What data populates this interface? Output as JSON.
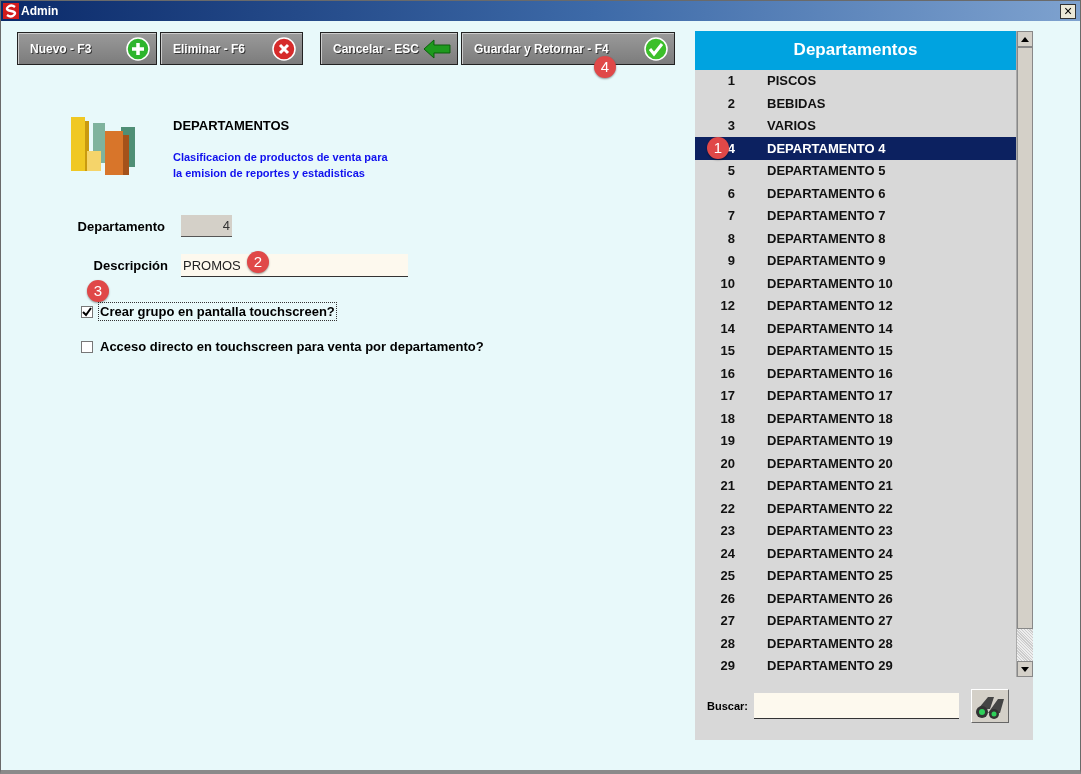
{
  "window": {
    "title": "Admin",
    "close": "×"
  },
  "toolbar": [
    {
      "label": "Nuevo - F3",
      "kind": "add"
    },
    {
      "label": "Eliminar - F6",
      "kind": "delete"
    },
    {
      "label": "Cancelar - ESC",
      "kind": "back"
    },
    {
      "label": "Guardar y Retornar - F4",
      "kind": "ok",
      "badge": "4"
    }
  ],
  "header": {
    "title": "DEPARTAMENTOS",
    "description": "Clasificacion de productos de venta para la emision de reportes y estadisticas"
  },
  "form": {
    "department": {
      "label": "Departamento",
      "value": "4"
    },
    "description": {
      "label": "Descripción",
      "value": "PROMOS",
      "badge": "2"
    },
    "checkboxes": [
      {
        "label": "Crear grupo en pantalla touchscreen?",
        "checked": true,
        "badge": "3"
      },
      {
        "label": "Acceso directo en touchscreen para venta por departamento?",
        "checked": false
      }
    ]
  },
  "list": {
    "title": "Departamentos",
    "items": [
      {
        "number": "1",
        "name": "PISCOS",
        "selected": false
      },
      {
        "number": "2",
        "name": "BEBIDAS",
        "selected": false
      },
      {
        "number": "3",
        "name": "VARIOS",
        "selected": false
      },
      {
        "number": "4",
        "name": "DEPARTAMENTO 4",
        "selected": true,
        "badge": "1"
      },
      {
        "number": "5",
        "name": "DEPARTAMENTO 5",
        "selected": false
      },
      {
        "number": "6",
        "name": "DEPARTAMENTO 6",
        "selected": false
      },
      {
        "number": "7",
        "name": "DEPARTAMENTO 7",
        "selected": false
      },
      {
        "number": "8",
        "name": "DEPARTAMENTO 8",
        "selected": false
      },
      {
        "number": "9",
        "name": "DEPARTAMENTO 9",
        "selected": false
      },
      {
        "number": "10",
        "name": "DEPARTAMENTO 10",
        "selected": false
      },
      {
        "number": "12",
        "name": "DEPARTAMENTO 12",
        "selected": false
      },
      {
        "number": "14",
        "name": "DEPARTAMENTO 14",
        "selected": false
      },
      {
        "number": "15",
        "name": "DEPARTAMENTO 15",
        "selected": false
      },
      {
        "number": "16",
        "name": "DEPARTAMENTO 16",
        "selected": false
      },
      {
        "number": "17",
        "name": "DEPARTAMENTO 17",
        "selected": false
      },
      {
        "number": "18",
        "name": "DEPARTAMENTO 18",
        "selected": false
      },
      {
        "number": "19",
        "name": "DEPARTAMENTO 19",
        "selected": false
      },
      {
        "number": "20",
        "name": "DEPARTAMENTO 20",
        "selected": false
      },
      {
        "number": "21",
        "name": "DEPARTAMENTO 21",
        "selected": false
      },
      {
        "number": "22",
        "name": "DEPARTAMENTO 22",
        "selected": false
      },
      {
        "number": "23",
        "name": "DEPARTAMENTO 23",
        "selected": false
      },
      {
        "number": "24",
        "name": "DEPARTAMENTO 24",
        "selected": false
      },
      {
        "number": "25",
        "name": "DEPARTAMENTO 25",
        "selected": false
      },
      {
        "number": "26",
        "name": "DEPARTAMENTO 26",
        "selected": false
      },
      {
        "number": "27",
        "name": "DEPARTAMENTO 27",
        "selected": false
      },
      {
        "number": "28",
        "name": "DEPARTAMENTO 28",
        "selected": false
      },
      {
        "number": "29",
        "name": "DEPARTAMENTO 29",
        "selected": false
      }
    ],
    "search": {
      "label": "Buscar:"
    }
  }
}
